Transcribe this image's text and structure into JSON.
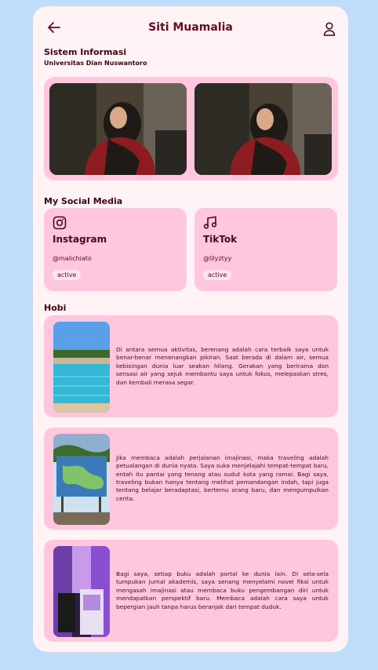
{
  "header": {
    "title": "Siti Muamalia"
  },
  "profile": {
    "major": "Sistem Informasi",
    "university": "Universitas Dian Nuswantoro"
  },
  "social": {
    "section_title": "My Social Media",
    "items": [
      {
        "icon": "instagram-icon",
        "name": "Instagram",
        "handle": "@malichiato",
        "status": "active"
      },
      {
        "icon": "music-note-icon",
        "name": "TikTok",
        "handle": "@lilyztyy",
        "status": "active"
      }
    ]
  },
  "hobbies": {
    "section_title": "Hobi",
    "items": [
      {
        "text": "Di antara semua aktivitas, berenang adalah cara terbaik saya untuk benar-benar menenangkan pikiran. Saat berada di dalam air, semua kebisingan dunia luar seakan hilang. Gerakan yang berirama dan sensasi air yang sejuk membantu saya untuk fokus, melepaskan stres, dan kembali merasa segar."
      },
      {
        "text": "Jika membaca adalah perjalanan imajinasi, maka traveling adalah petualangan di dunia nyata. Saya suka menjelajahi tempat-tempat baru, entah itu pantai yang tenang atau sudut kota yang ramai. Bagi saya, traveling bukan hanya tentang melihat pemandangan indah, tapi juga tentang belajar beradaptasi, bertemu orang baru, dan mengumpulkan cerita."
      },
      {
        "text": "Bagi saya, setiap buku adalah portal ke dunia lain. Di sela-sela tumpukan jurnal akademis, saya senang menyelami novel fiksi untuk mengasah imajinasi atau membaca buku pengembangan diri untuk mendapatkan perspektif baru. Membaca adalah cara saya untuk bepergian jauh tanpa harus beranjak dari tempat duduk."
      }
    ]
  },
  "colors": {
    "accent": "#6b0a1e",
    "card": "#ffc6dd",
    "background": "#bfdcfb"
  }
}
